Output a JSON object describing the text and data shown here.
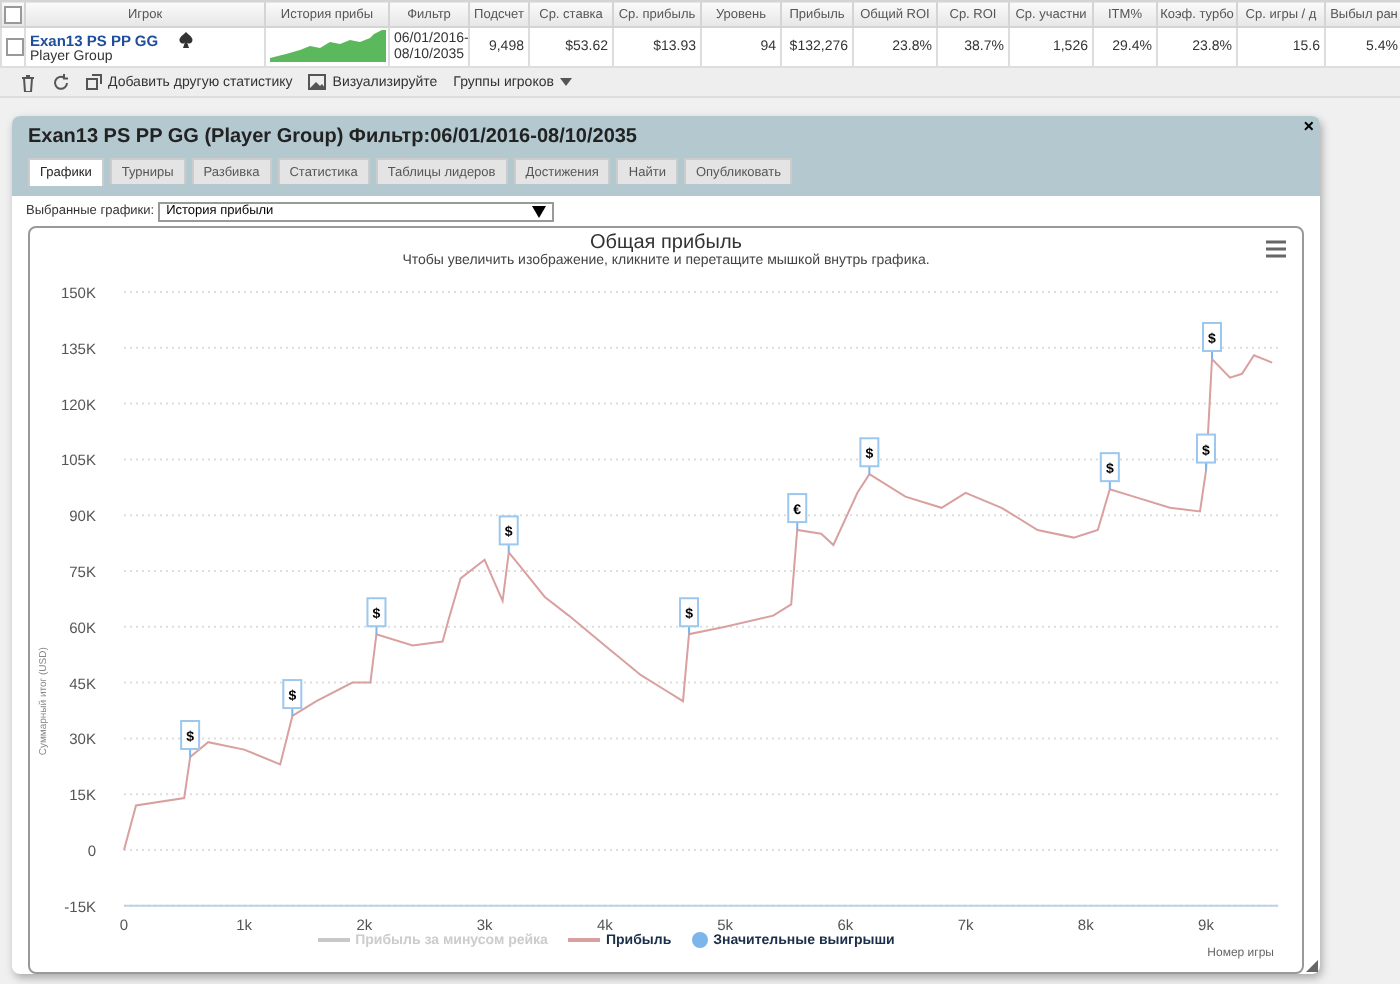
{
  "table": {
    "all_checked": false,
    "player_column": "Игрок",
    "history_column": "История прибы",
    "filter_column": "Фильтр",
    "columns": [
      "Подсчет",
      "Ср. ставка",
      "Ср. прибыль",
      "Уровень",
      "Прибыль",
      "Общий ROI",
      "Ср. ROI",
      "Ср. участни",
      "ITM%",
      "Коэф. турбо",
      "Ср. игры / д",
      "Выбыл ран"
    ],
    "rows": [
      {
        "checked": false,
        "player": "Exan13 PS PP GG",
        "group": "Player Group",
        "filter": "06/01/2016-08/10/2035",
        "cells": [
          "9,498",
          "$53.62",
          "$13.93",
          "94",
          "$132,276",
          "23.8%",
          "38.7%",
          "1,526",
          "29.4%",
          "23.8%",
          "15.6",
          "5.4%"
        ]
      }
    ]
  },
  "toolbar": [
    {
      "kind": "trash"
    },
    {
      "kind": "refresh"
    },
    {
      "kind": "add",
      "label": "Добавить другую статистику"
    },
    {
      "kind": "image",
      "label": "Визуализируйте"
    },
    {
      "kind": "dropdown",
      "label": "Группы игроков"
    }
  ],
  "dialog": {
    "title": "Exan13 PS PP GG (Player Group) Фильтр:06/01/2016-08/10/2035",
    "close": "×",
    "tabs": [
      {
        "label": "Графики",
        "selected": true
      },
      {
        "label": "Турниры",
        "selected": false
      },
      {
        "label": "Разбивка",
        "selected": false
      },
      {
        "label": "Статистика",
        "selected": false
      },
      {
        "label": "Таблицы лидеров",
        "selected": false
      },
      {
        "label": "Достижения",
        "selected": false
      },
      {
        "label": "Найти",
        "selected": false
      },
      {
        "label": "Опубликовать",
        "selected": false
      }
    ],
    "select_label": "Выбранные графики:",
    "select_value": "История прибыли",
    "chart": {
      "subtitle": "Чтобы увеличить изображение, кликните и перетащите мышкой внутрь графика.",
      "legend": [
        {
          "kind": "line",
          "label": "Прибыль за минусом рейка",
          "visible": false,
          "color": "#c8c8c8"
        },
        {
          "kind": "series",
          "visible": true
        },
        {
          "kind": "dot",
          "label": "Значительные выигрыши",
          "visible": true,
          "color": "#7cb5ec"
        }
      ],
      "chart_data": {
        "type": "line",
        "title": "Общая прибыль",
        "xlabel": "Номер игры",
        "ylabel": "Суммарный итог (USD)",
        "x": [
          0,
          100,
          500,
          550,
          700,
          1000,
          1300,
          1400,
          1600,
          1900,
          2050,
          2100,
          2400,
          2650,
          2700,
          2800,
          3000,
          3150,
          3200,
          3300,
          3500,
          3700,
          4000,
          4300,
          4500,
          4650,
          4700,
          5000,
          5400,
          5550,
          5600,
          5800,
          5900,
          6100,
          6200,
          6500,
          6800,
          7000,
          7300,
          7600,
          7900,
          8100,
          8200,
          8400,
          8700,
          8950,
          9000,
          9050,
          9200,
          9300,
          9400,
          9550
        ],
        "series": [
          {
            "name": "Прибыль",
            "color": "#d9a0a0",
            "values": [
              0,
              12000,
              14000,
              25000,
              29000,
              27000,
              23000,
              36000,
              40000,
              45000,
              45000,
              58000,
              55000,
              56000,
              62000,
              73000,
              78000,
              67000,
              80000,
              76000,
              68000,
              63000,
              55000,
              47000,
              43000,
              40000,
              58000,
              60000,
              63000,
              66000,
              86000,
              85000,
              82000,
              96000,
              101000,
              95000,
              92000,
              96000,
              92000,
              86000,
              84000,
              86000,
              97000,
              95000,
              92000,
              91000,
              102000,
              132000,
              127000,
              128000,
              133000,
              131000
            ]
          }
        ],
        "grid": true,
        "xlim": [
          0,
          9600
        ],
        "ylim": [
          -15000,
          150000
        ],
        "xticks": [
          {
            "value": 0,
            "label": "0"
          },
          {
            "value": 1000,
            "label": "1k"
          },
          {
            "value": 2000,
            "label": "2k"
          },
          {
            "value": 3000,
            "label": "3k"
          },
          {
            "value": 4000,
            "label": "4k"
          },
          {
            "value": 5000,
            "label": "5k"
          },
          {
            "value": 6000,
            "label": "6k"
          },
          {
            "value": 7000,
            "label": "7k"
          },
          {
            "value": 8000,
            "label": "8k"
          },
          {
            "value": 9000,
            "label": "9k"
          }
        ],
        "yticks": [
          {
            "value": -15000,
            "label": "-15K"
          },
          {
            "value": 0,
            "label": "0"
          },
          {
            "value": 15000,
            "label": "15K"
          },
          {
            "value": 30000,
            "label": "30K"
          },
          {
            "value": 45000,
            "label": "45K"
          },
          {
            "value": 60000,
            "label": "60K"
          },
          {
            "value": 75000,
            "label": "75K"
          },
          {
            "value": 90000,
            "label": "90K"
          },
          {
            "value": 105000,
            "label": "105K"
          },
          {
            "value": 120000,
            "label": "120K"
          },
          {
            "value": 135000,
            "label": "135K"
          },
          {
            "value": 150000,
            "label": "150K"
          }
        ],
        "annotations": [
          {
            "x": 550,
            "y": 25000,
            "text": "$"
          },
          {
            "x": 1400,
            "y": 36000,
            "text": "$"
          },
          {
            "x": 2100,
            "y": 58000,
            "text": "$"
          },
          {
            "x": 3200,
            "y": 80000,
            "text": "$"
          },
          {
            "x": 4700,
            "y": 58000,
            "text": "$"
          },
          {
            "x": 5600,
            "y": 86000,
            "text": "€"
          },
          {
            "x": 6200,
            "y": 101000,
            "text": "$"
          },
          {
            "x": 8200,
            "y": 97000,
            "text": "$"
          },
          {
            "x": 9000,
            "y": 102000,
            "text": "$"
          },
          {
            "x": 9050,
            "y": 132000,
            "text": "$"
          }
        ]
      }
    }
  }
}
